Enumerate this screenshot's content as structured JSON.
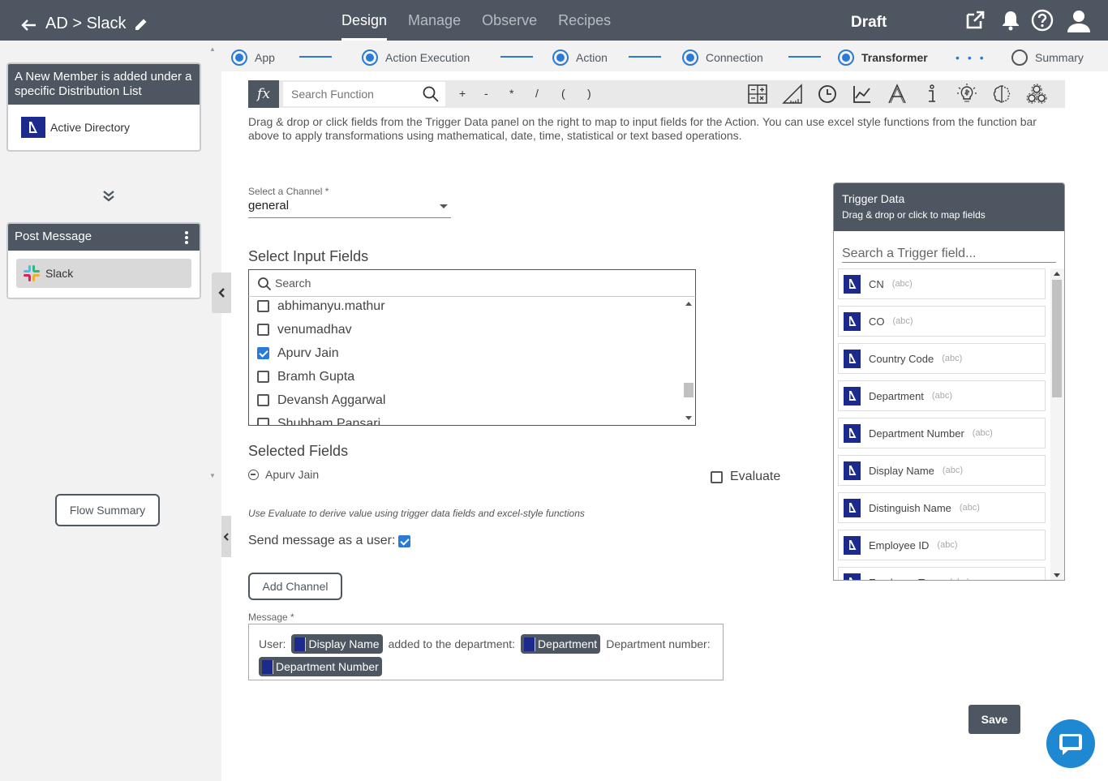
{
  "header": {
    "breadcrumb": "AD > Slack",
    "tabs": [
      {
        "label": "Design",
        "active": true
      },
      {
        "label": "Manage",
        "active": false
      },
      {
        "label": "Observe",
        "active": false
      },
      {
        "label": "Recipes",
        "active": false
      }
    ],
    "status": "Draft",
    "icons": [
      "external-link-icon",
      "bell-icon",
      "help-icon",
      "user-icon"
    ]
  },
  "sidebar": {
    "trigger_card": {
      "title": "A New Member is added under a specific Distribution List",
      "app": "Active Directory"
    },
    "action_card": {
      "title": "Post Message",
      "app": "Slack"
    },
    "flow_summary_label": "Flow Summary"
  },
  "stepper": {
    "steps": [
      {
        "label": "App",
        "state": "done"
      },
      {
        "label": "Action Execution",
        "state": "done"
      },
      {
        "label": "Action",
        "state": "done"
      },
      {
        "label": "Connection",
        "state": "done"
      },
      {
        "label": "Transformer",
        "state": "current"
      },
      {
        "label": "Summary",
        "state": "pending"
      }
    ]
  },
  "function_bar": {
    "fx_label": "fx",
    "search_placeholder": "Search Function",
    "operators": [
      "+",
      "-",
      "*",
      "/",
      "(",
      ")"
    ],
    "tools": [
      "calculator-icon",
      "ruler-triangle-icon",
      "clock-icon",
      "line-chart-icon",
      "text-format-icon",
      "info-icon",
      "idea-dollar-icon",
      "brain-icon",
      "gears-icon"
    ]
  },
  "description": "Drag & drop or click fields from the Trigger Data panel on the right to map to input fields for the Action. You can use excel style functions from the function bar above to apply transformations using mathematical, date, time, statistical or text based operations.",
  "channel": {
    "label": "Select a Channel *",
    "value": "general"
  },
  "input_fields": {
    "title": "Select Input Fields",
    "search_placeholder": "Search",
    "items": [
      {
        "name": "abhimanyu.mathur",
        "checked": false
      },
      {
        "name": "venumadhav",
        "checked": false
      },
      {
        "name": "Apurv Jain",
        "checked": true
      },
      {
        "name": "Bramh Gupta",
        "checked": false
      },
      {
        "name": "Devansh Aggarwal",
        "checked": false
      },
      {
        "name": "Shubham Pansari",
        "checked": false
      }
    ]
  },
  "selected_fields": {
    "title": "Selected Fields",
    "items": [
      "Apurv Jain"
    ],
    "evaluate_label": "Evaluate",
    "evaluate_checked": false
  },
  "evaluate_hint": "Use Evaluate to derive value using trigger data fields and excel-style functions",
  "send_as_user": {
    "label": "Send message as a user:",
    "checked": true
  },
  "add_channel_label": "Add Channel",
  "message": {
    "label": "Message *",
    "parts": {
      "t1": "User:",
      "p1": "Display Name",
      "t2": "added to the department:",
      "p2": "Department",
      "t3": "Department number:",
      "p3": "Department Number"
    }
  },
  "save_label": "Save",
  "trigger_data": {
    "title": "Trigger Data",
    "subtitle": "Drag & drop or click to map fields",
    "search_placeholder": "Search a Trigger field...",
    "fields": [
      {
        "name": "CN",
        "type": "(abc)"
      },
      {
        "name": "CO",
        "type": "(abc)"
      },
      {
        "name": "Country Code",
        "type": "(abc)"
      },
      {
        "name": "Department",
        "type": "(abc)"
      },
      {
        "name": "Department Number",
        "type": "(abc)"
      },
      {
        "name": "Display Name",
        "type": "(abc)"
      },
      {
        "name": "Distinguish Name",
        "type": "(abc)"
      },
      {
        "name": "Employee ID",
        "type": "(abc)"
      },
      {
        "name": "Employee Type",
        "type": "(abc)"
      }
    ]
  },
  "colors": {
    "header_bg": "#4e5761",
    "accent": "#2a7ad6",
    "ad_brand": "#1b2a8c",
    "chat_button": "#1e88d2"
  }
}
